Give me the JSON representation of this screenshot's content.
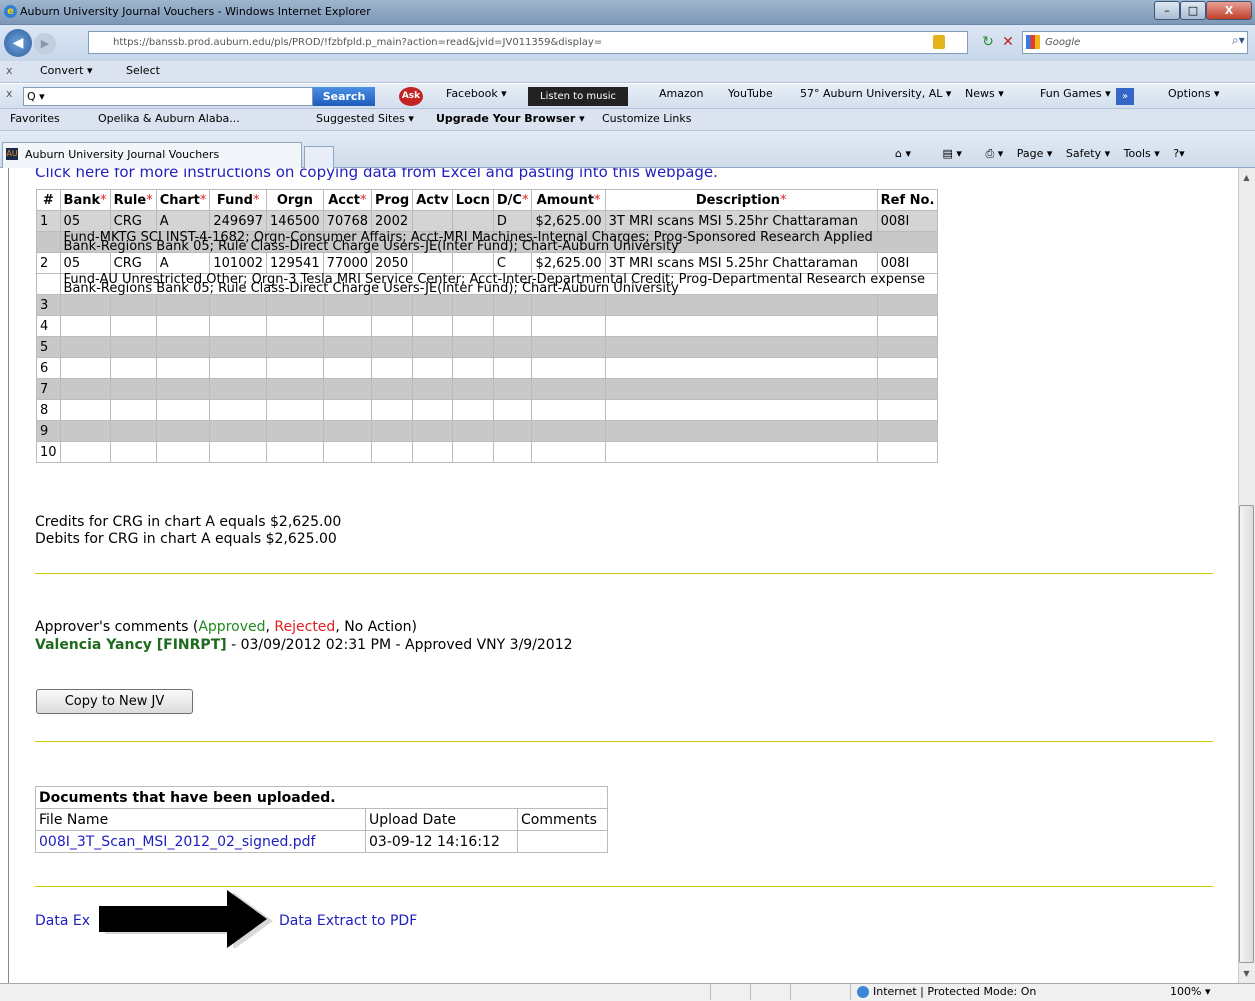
{
  "window": {
    "title": "Auburn University Journal Vouchers - Windows Internet Explorer",
    "min": "–",
    "max": "□",
    "close": "X"
  },
  "address": {
    "url": "https://banssb.prod.auburn.edu/pls/PROD/!fzbfpld.p_main?action=read&jvid=JV011359&display=",
    "search_placeholder": "Google"
  },
  "toolbar1": {
    "close": "x",
    "convert": "Convert ▾",
    "select": "Select"
  },
  "toolbar2": {
    "close": "x",
    "search_value": "Q ▾",
    "search_btn": "Search",
    "ask": "Ask",
    "facebook": "Facebook ▾",
    "music": "Listen to music",
    "amazon": "Amazon",
    "youtube": "YouTube",
    "weather": "57° Auburn University, AL ▾",
    "news": "News ▾",
    "games": "Fun Games ▾",
    "more": "»",
    "options": "Options ▾"
  },
  "favorites": {
    "label": "Favorites",
    "item1": "Opelika & Auburn Alaba...",
    "item2": "Suggested Sites ▾",
    "item3": "Upgrade Your Browser ▾",
    "item4": "Customize Links"
  },
  "tab": {
    "label": "Auburn University Journal Vouchers"
  },
  "cmd": {
    "page": "Page ▾",
    "safety": "Safety ▾",
    "tools": "Tools ▾",
    "help": "?▾"
  },
  "page": {
    "instructions_link": "Click here for more instructions on copying data from Excel and pasting into this webpage.",
    "columns": [
      "#",
      "Bank",
      "Rule",
      "Chart",
      "Fund",
      "Orgn",
      "Acct",
      "Prog",
      "Actv",
      "Locn",
      "D/C",
      "Amount",
      "Description",
      "Ref No."
    ],
    "rows": [
      {
        "n": "1",
        "bank": "05",
        "rule": "CRG",
        "chart": "A",
        "fund": "249697",
        "orgn": "146500",
        "acct": "70768",
        "prog": "2002",
        "actv": "",
        "locn": "",
        "dc": "D",
        "amount": "$2,625.00",
        "desc": "3T MRI scans MSI 5.25hr Chattaraman",
        "ref": "008I",
        "info_line1": "Fund-MKTG SCI INST-4-1682; Orgn-Consumer Affairs; Acct-MRI Machines-Internal Charges; Prog-Sponsored Research Applied",
        "info_line2": "Bank-Regions Bank 05; Rule Class-Direct Charge Users-JE(Inter Fund); Chart-Auburn University"
      },
      {
        "n": "2",
        "bank": "05",
        "rule": "CRG",
        "chart": "A",
        "fund": "101002",
        "orgn": "129541",
        "acct": "77000",
        "prog": "2050",
        "actv": "",
        "locn": "",
        "dc": "C",
        "amount": "$2,625.00",
        "desc": "3T MRI scans MSI 5.25hr Chattaraman",
        "ref": "008I",
        "info_line1": "Fund-AU Unrestricted Other; Orgn-3 Tesla MRI Service Center; Acct-Inter-Departmental Credit; Prog-Departmental Research expense",
        "info_line2": "Bank-Regions Bank 05; Rule Class-Direct Charge Users-JE(Inter Fund); Chart-Auburn University"
      }
    ],
    "empty_rows": [
      "3",
      "4",
      "5",
      "6",
      "7",
      "8",
      "9",
      "10"
    ],
    "credits": "Credits for CRG in chart A equals $2,625.00",
    "debits": "Debits for CRG in chart A equals $2,625.00",
    "comments_prefix": "Approver's comments (",
    "approved": "Approved",
    "comma": ", ",
    "rejected": "Rejected",
    "noaction": ", No Action)",
    "approver_name": "Valencia Yancy [FINRPT]",
    "approver_detail": " - 03/09/2012 02:31 PM - Approved VNY 3/9/2012",
    "copy_button": "Copy to New JV",
    "docs_title": "Documents that have been uploaded.",
    "docs_cols": [
      "File Name",
      "Upload Date",
      "Comments"
    ],
    "doc_file": "008I_3T_Scan_MSI_2012_02_signed.pdf",
    "doc_date": "03-09-12 14:16:12",
    "doc_comments": "",
    "extract_excel": "Data Ex",
    "extract_pdf": "Data Extract to PDF"
  },
  "status": {
    "zone": "Internet | Protected Mode: On",
    "zoom": "100%  ▾"
  }
}
